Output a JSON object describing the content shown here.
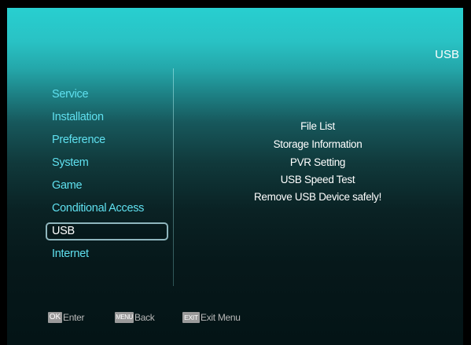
{
  "screen": {
    "title": "USB"
  },
  "menu": {
    "items": [
      {
        "label": "Service"
      },
      {
        "label": "Installation"
      },
      {
        "label": "Preference"
      },
      {
        "label": "System"
      },
      {
        "label": "Game"
      },
      {
        "label": "Conditional Access"
      },
      {
        "label": "USB",
        "selected": true
      },
      {
        "label": "Internet"
      }
    ]
  },
  "submenu": {
    "items": [
      {
        "label": "File List"
      },
      {
        "label": "Storage Information"
      },
      {
        "label": "PVR Setting"
      },
      {
        "label": "USB Speed Test"
      },
      {
        "label": "Remove USB Device safely!"
      }
    ]
  },
  "hints": [
    {
      "key": "OK",
      "label": "Enter"
    },
    {
      "key": "MENU",
      "label": "Back"
    },
    {
      "key": "EXIT",
      "label": "Exit Menu"
    }
  ],
  "colors": {
    "menu_text": "#5fe0ef",
    "selected_text": "#ffffff",
    "highlight_border": "#8fb6bd",
    "key_badge": "#9a9a9a"
  }
}
